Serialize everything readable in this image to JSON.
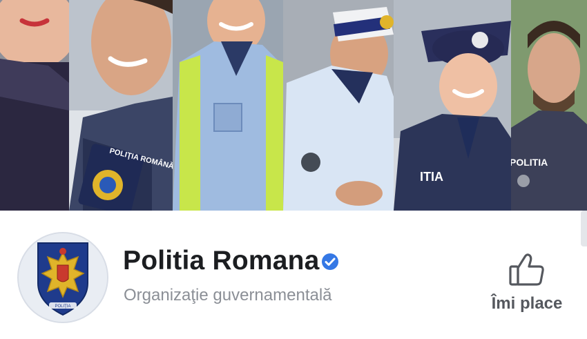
{
  "page": {
    "name": "Politia Romana",
    "category": "Organizaţie guvernamentală",
    "verified": true
  },
  "like_button": {
    "label": "Îmi place",
    "icon": "thumbs-up-icon"
  },
  "cover": {
    "badge_text_left": "POLIŢIA ROMÂNĂ",
    "badge_text_right": "POLITIA",
    "vehicle_text": "ITIA"
  },
  "avatar": {
    "emblem_text": "POLIŢIA",
    "icon": "police-crest-icon"
  },
  "colors": {
    "accent": "#3578e5",
    "uniform_navy": "#2c3558",
    "shirt_blue": "#9fbbe0",
    "vest_yellow": "#c8e64a",
    "crest_gold": "#e0b42a"
  }
}
